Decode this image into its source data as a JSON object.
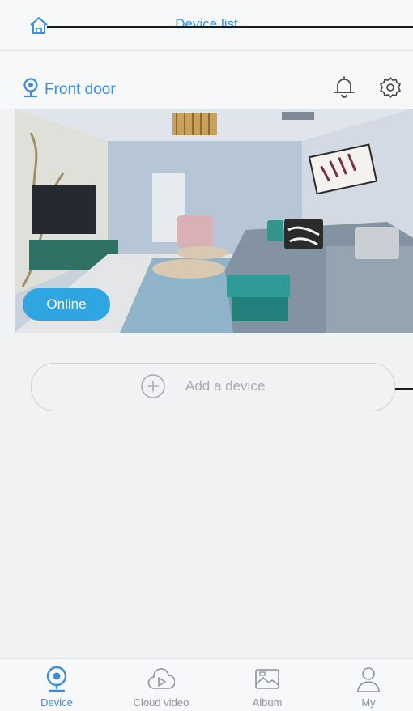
{
  "header": {
    "title": "Device list"
  },
  "device": {
    "name": "Front door",
    "status": "Online"
  },
  "add_device": {
    "label": "Add a device"
  },
  "tabs": [
    {
      "label": "Device",
      "icon": "camera-icon",
      "active": true
    },
    {
      "label": "Cloud video",
      "icon": "cloud-play-icon",
      "active": false
    },
    {
      "label": "Album",
      "icon": "album-icon",
      "active": false
    },
    {
      "label": "My",
      "icon": "person-icon",
      "active": false
    }
  ],
  "colors": {
    "accent": "#3a8fdd",
    "online_badge": "#2fa6e2",
    "background": "#f1f2f4"
  }
}
